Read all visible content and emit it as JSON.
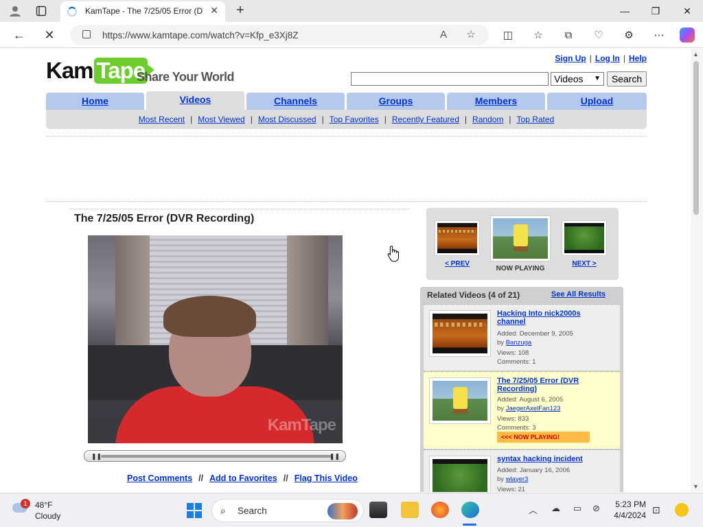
{
  "browser": {
    "tab_title": "KamTape - The 7/25/05 Error (DV",
    "url": "https://www.kamtape.com/watch?v=Kfp_e3Xj8Z",
    "new_tab_glyph": "+",
    "close_glyph": "✕"
  },
  "site": {
    "logo_kam": "Kam",
    "logo_tape": "Tape",
    "tagline": "Share Your World",
    "top_links": [
      "Sign Up",
      "Log In",
      "Help"
    ],
    "search": {
      "value": "",
      "category": "Videos",
      "button": "Search"
    },
    "nav_tabs": [
      "Home",
      "Videos",
      "Channels",
      "Groups",
      "Members",
      "Upload"
    ],
    "active_tab": "Videos",
    "sub_nav": [
      "Most Recent",
      "Most Viewed",
      "Most Discussed",
      "Top Favorites",
      "Recently Featured",
      "Random",
      "Top Rated"
    ]
  },
  "video": {
    "title": "The 7/25/05 Error (DVR Recording)",
    "watermark": "KamTape",
    "actions": [
      "Post Comments",
      "Add to Favorites",
      "Flag This Video"
    ],
    "action_separator": "//"
  },
  "navigator": {
    "prev": "< PREV",
    "now_playing": "NOW PLAYING",
    "next": "NEXT >"
  },
  "related": {
    "header": "Related Videos (4 of 21)",
    "see_all": "See All Results",
    "items": [
      {
        "title": "Hacking Into nick2000s channel",
        "added": "Added: December 9, 2005",
        "by_prefix": "by",
        "author": "Banzuga",
        "views": "Views: 108",
        "comments": "Comments: 1",
        "thumb": "dark"
      },
      {
        "title": "The 7/25/05 Error (DVR Recording)",
        "added": "Added: August 6, 2005",
        "by_prefix": "by",
        "author": "JaegerAxelFan123",
        "views": "Views: 833",
        "comments": "Comments: 3",
        "now_playing": "<<< NOW PLAYING!",
        "thumb": "sponge"
      },
      {
        "title": "syntax hacking incident",
        "added": "Added: January 16, 2006",
        "by_prefix": "by",
        "author": "wlayer3",
        "views": "Views: 21",
        "thumb": "green"
      }
    ]
  },
  "taskbar": {
    "weather_temp": "48°F",
    "weather_cond": "Cloudy",
    "weather_badge": "1",
    "search_label": "Search",
    "time": "5:23 PM",
    "date": "4/4/2024"
  },
  "colors": {
    "link": "#0033cc",
    "nav_tab": "#b5c9ef",
    "logo_green": "#6dcc2e",
    "now_playing_bg": "#ffffcc"
  }
}
